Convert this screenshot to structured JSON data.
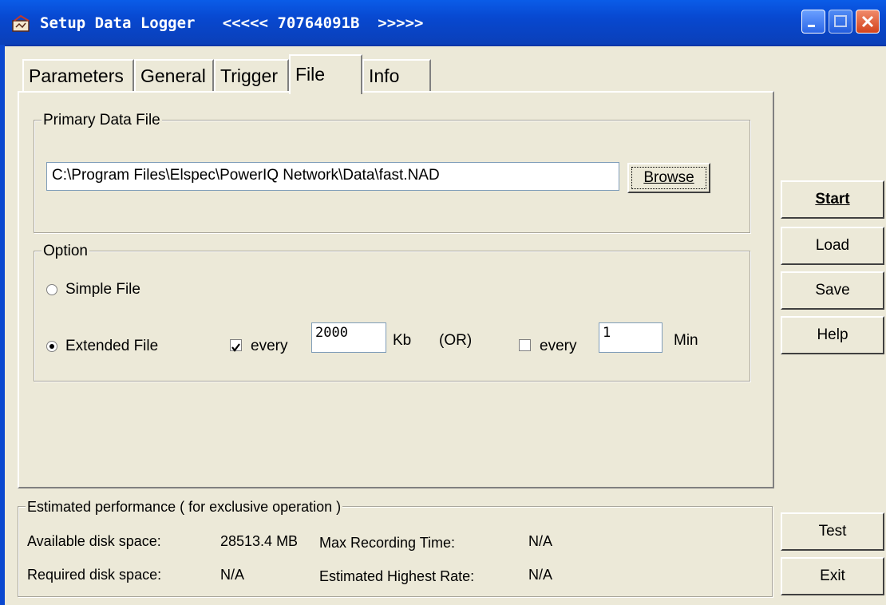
{
  "window": {
    "title": "Setup Data Logger",
    "title_left_arrows": "<<<<<",
    "device_id": "70764091B",
    "title_right_arrows": ">>>>>",
    "titlebar_color": "#0a5ce8"
  },
  "tabs": [
    {
      "label": "Parameters",
      "active": false
    },
    {
      "label": "General",
      "active": false
    },
    {
      "label": "Trigger",
      "active": false
    },
    {
      "label": "File",
      "active": true
    },
    {
      "label": "Info",
      "active": false
    }
  ],
  "primary_data_file": {
    "group_label": "Primary Data File",
    "path": "C:\\Program Files\\Elspec\\PowerIQ Network\\Data\\fast.NAD",
    "browse_label": "Browse"
  },
  "option": {
    "group_label": "Option",
    "simple_file_label": "Simple  File",
    "simple_file_selected": false,
    "extended_file_label": "Extended  File",
    "extended_file_selected": true,
    "every_kb_checked": true,
    "every_label_1": "every",
    "kb_value": "2000",
    "kb_unit": "Kb",
    "or_label": "(OR)",
    "every_min_checked": false,
    "every_label_2": "every",
    "min_value": "1",
    "min_unit": "Min"
  },
  "side_buttons": {
    "start": "Start",
    "load": "Load",
    "save": "Save",
    "help": "Help",
    "test": "Test",
    "exit": "Exit"
  },
  "performance": {
    "group_label": "Estimated performance ( for exclusive operation )",
    "available_label": "Available  disk space:",
    "available_value": "28513.4 MB",
    "max_time_label": "Max Recording Time:",
    "max_time_value": "N/A",
    "required_label": "Required disk space:",
    "required_value": "N/A",
    "highest_rate_label": "Estimated Highest Rate:",
    "highest_rate_value": "N/A"
  }
}
